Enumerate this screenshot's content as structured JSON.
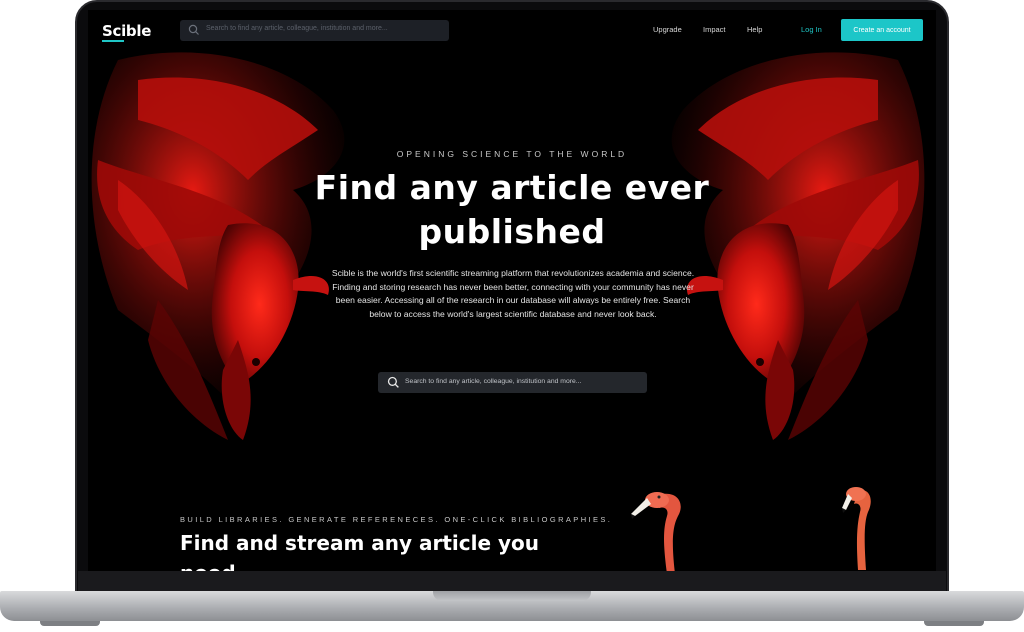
{
  "nav": {
    "logo": "Scible",
    "search_placeholder": "Search to find any article, colleague, institution and more...",
    "links": {
      "upgrade": "Upgrade",
      "impact": "Impact",
      "help": "Help"
    },
    "login": "Log In",
    "create_account": "Create an account"
  },
  "hero": {
    "eyebrow": "OPENING SCIENCE TO THE WORLD",
    "title": "Find any article ever published",
    "body": "Scible is the world's first scientific streaming platform that revolutionizes academia and science. Finding and storing research has never been better, connecting with your community has never been easier. Accessing all of the research in our database will always be entirely free. Search below to access the world's largest scientific database and never look back.",
    "search_placeholder": "Search to find any article, colleague, institution and more..."
  },
  "section": {
    "eyebrow": "BUILD LIBRARIES. GENERATE REFERENECES. ONE-CLICK BIBLIOGRAPHIES.",
    "title": "Find and stream any article you need,"
  },
  "colors": {
    "accent": "#1cc6c8",
    "background": "#000000",
    "fish_red": "#d01010"
  },
  "icons": [
    "search-icon",
    "camera-icon"
  ]
}
